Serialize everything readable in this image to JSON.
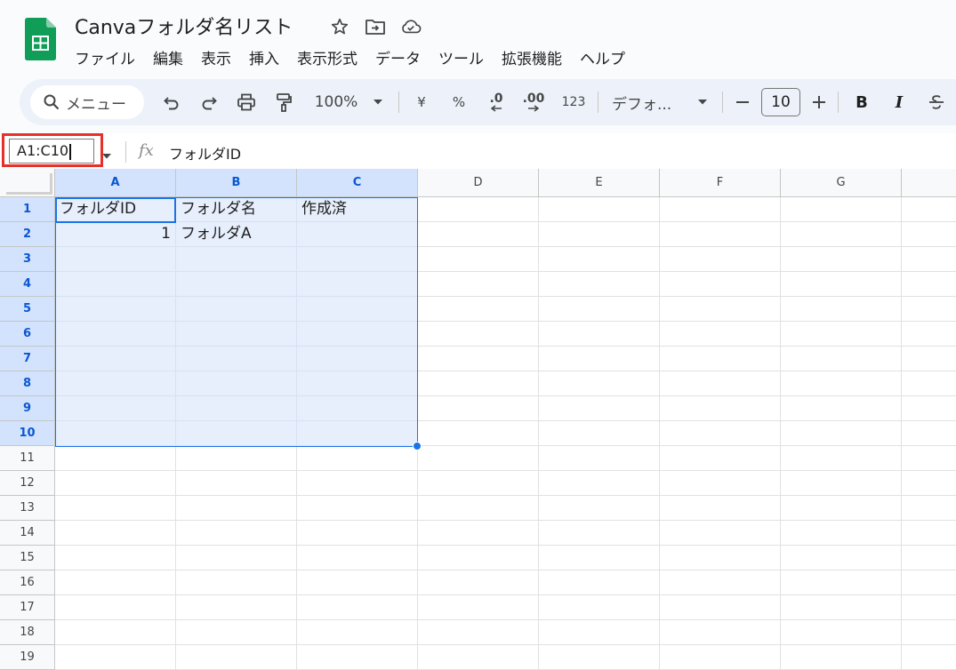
{
  "title": "Canvaフォルダ名リスト",
  "title_icons": [
    "star-icon",
    "move-to-folder-icon",
    "cloud-saved-icon"
  ],
  "menu": [
    "ファイル",
    "編集",
    "表示",
    "挿入",
    "表示形式",
    "データ",
    "ツール",
    "拡張機能",
    "ヘルプ"
  ],
  "toolbar": {
    "search_label": "メニュー",
    "zoom": "100%",
    "currency": "¥",
    "percent": "%",
    "decrease_decimal": ".0",
    "increase_decimal": ".00",
    "number_format": "123",
    "font": "デフォ...",
    "font_size": "10",
    "bold": "B",
    "italic": "I"
  },
  "formula_bar": {
    "name_box": "A1:C10",
    "fx": "fx",
    "content": "フォルダID"
  },
  "columns": [
    "A",
    "B",
    "C",
    "D",
    "E",
    "F",
    "G"
  ],
  "rows": [
    "1",
    "2",
    "3",
    "4",
    "5",
    "6",
    "7",
    "8",
    "9",
    "10",
    "11",
    "12",
    "13",
    "14",
    "15",
    "16",
    "17",
    "18",
    "19"
  ],
  "cells": {
    "A1": "フォルダID",
    "B1": "フォルダ名",
    "C1": "作成済",
    "A2": "1",
    "B2": "フォルダA"
  },
  "selection": "A1:C10",
  "colors": {
    "selection_fill": "#e7effd",
    "selection_border": "#1a73e8",
    "header_selected": "#d3e3fd",
    "highlight_box": "#e8302a",
    "sheets_green": "#0f9d58"
  }
}
